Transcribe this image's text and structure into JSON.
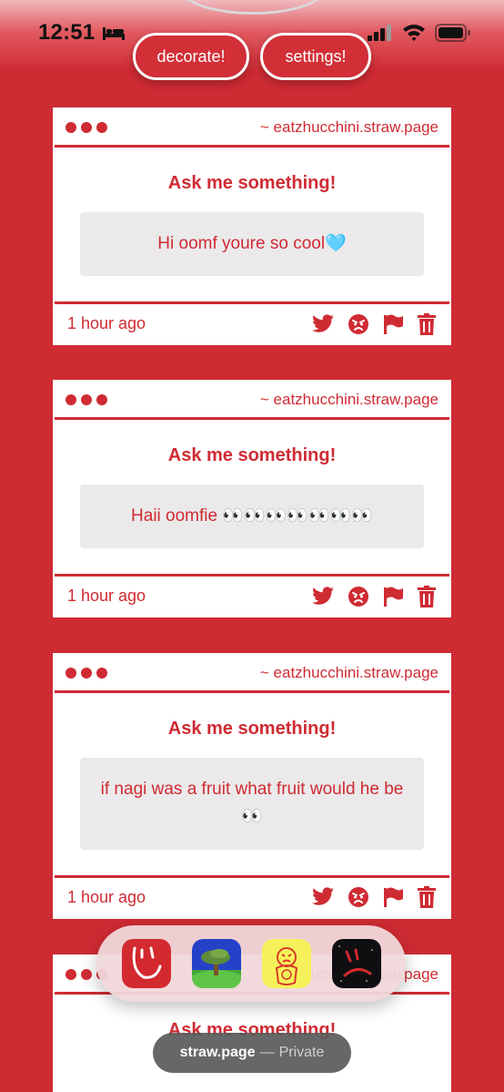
{
  "status_bar": {
    "time": "12:51",
    "icons": [
      "bed-icon",
      "signal-icon",
      "wifi-icon",
      "battery-icon"
    ]
  },
  "top_buttons": {
    "decorate": "decorate!",
    "settings": "settings!"
  },
  "cards": [
    {
      "url": "~ eatzhucchini.straw.page",
      "title": "Ask me something!",
      "question": "Hi oomf youre so cool🩵",
      "timestamp": "1 hour ago"
    },
    {
      "url": "~ eatzhucchini.straw.page",
      "title": "Ask me something!",
      "question": "Haii oomfie 👀👀👀👀👀👀👀",
      "timestamp": "1 hour ago"
    },
    {
      "url": "~ eatzhucchini.straw.page",
      "title": "Ask me something!",
      "question": "if nagi was a fruit what fruit would he be 👀",
      "timestamp": "1 hour ago"
    },
    {
      "url": "~ eatzhucchini.straw.page",
      "title": "Ask me something!",
      "question": "",
      "timestamp": ""
    }
  ],
  "card_actions": [
    "twitter-icon",
    "angry-face-icon",
    "flag-icon",
    "trash-icon"
  ],
  "dock_apps": [
    "red-smile-app-icon",
    "tree-landscape-app-icon",
    "yellow-money-app-icon",
    "dark-frown-app-icon"
  ],
  "browser": {
    "domain": "straw.page",
    "separator": "—",
    "mode": "Private"
  },
  "colors": {
    "accent": "#cf2b33",
    "card_bg": "#ffffff",
    "question_bg": "#ebe9ea"
  }
}
